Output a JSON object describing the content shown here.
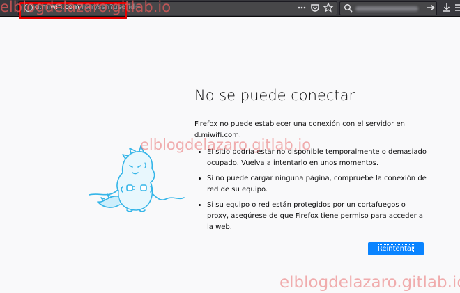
{
  "urlbar": {
    "domain": "d.miwifi.com",
    "path": "/rom/ssh?userid="
  },
  "error": {
    "title": "No se puede conectar",
    "description": "Firefox no puede establecer una conexión con el servidor en d.miwifi.com.",
    "items": [
      "El sitio podría estar no disponible temporalmente o demasiado ocupado. Vuelva a intentarlo en unos momentos.",
      "Si no puede cargar ninguna página, compruebe la conexión de red de su equipo.",
      "Si su equipo o red están protegidos por un cortafuegos o proxy, asegúrese de que Firefox tiene permiso para acceder a la web."
    ],
    "retry_label": "Reintentar"
  },
  "watermark": {
    "text": "elblogdelazaro.gitlab.io"
  },
  "icons": {
    "info": "info-icon",
    "page_actions": "more-horizontal-icon",
    "pocket": "pocket-icon",
    "bookmark": "star-icon",
    "search": "search-icon",
    "go": "arrow-right-icon",
    "downloads": "download-icon",
    "menu": "hamburger-menu-icon"
  },
  "colors": {
    "toolbar": "#38383d",
    "accent": "#0a84ff",
    "highlight": "#e60000",
    "watermark": "#ea6e6e"
  }
}
